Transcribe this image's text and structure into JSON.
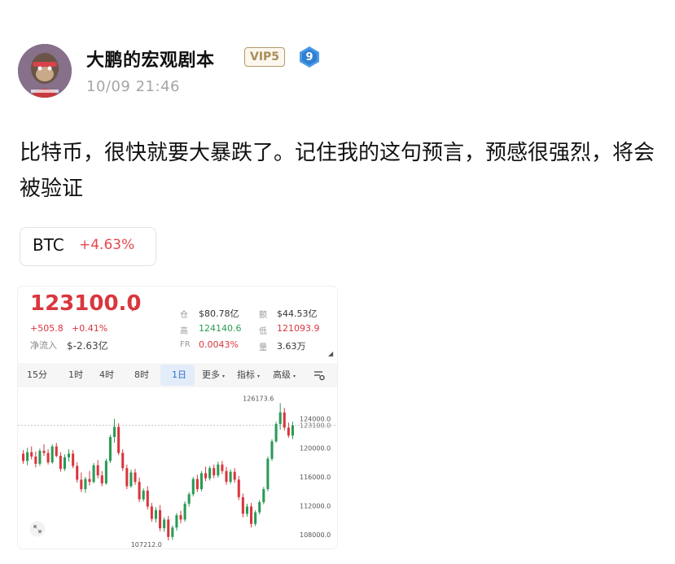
{
  "post": {
    "username": "大鹏的宏观剧本",
    "vip_badge": "VIP5",
    "level": "9",
    "timestamp": "10/09 21:46",
    "text": "比特币，很快就要大暴跌了。记住我的这句预言，预感很强烈，将会被验证"
  },
  "ticker_tag": {
    "symbol": "BTC",
    "change": "+4.63%"
  },
  "quote": {
    "price": "123100.0",
    "change_abs": "+505.8",
    "change_pct": "+0.41%",
    "net_inflow_label": "净流入",
    "net_inflow_value": "$-2.63亿",
    "stats": [
      {
        "label": "仓",
        "value": "$80.78亿",
        "value_color": "#333333"
      },
      {
        "label": "额",
        "value": "$44.53亿",
        "value_color": "#333333"
      },
      {
        "label": "高",
        "value": "124140.6",
        "value_color": "#2a9a55"
      },
      {
        "label": "低",
        "value": "121093.9",
        "value_color": "#d9363e"
      },
      {
        "label": "FR",
        "value": "0.0043%",
        "value_color": "#d9363e"
      },
      {
        "label": "量",
        "value": "3.63万",
        "value_color": "#333333"
      }
    ]
  },
  "timeframes": [
    "15分",
    "1时",
    "4时",
    "8时",
    "1日",
    "更多",
    "指标",
    "高级"
  ],
  "active_timeframe": "1日",
  "colors": {
    "up": "#2a9a55",
    "down": "#d9363e"
  },
  "chart_data": {
    "type": "candlestick",
    "y_ticks": [
      "124000.0",
      "123100.0",
      "120000.0",
      "116000.0",
      "112000.0",
      "108000.0"
    ],
    "annotations": {
      "high_label": "126173.6",
      "low_label": "107212.0"
    },
    "current_price": 123100.0,
    "ylim": [
      107000,
      127000
    ],
    "candles": [
      [
        119200,
        119700,
        117800,
        118200
      ],
      [
        118200,
        120000,
        117600,
        119400
      ],
      [
        119400,
        120200,
        118400,
        118800
      ],
      [
        118800,
        119500,
        117300,
        117800
      ],
      [
        117800,
        119900,
        117500,
        119600
      ],
      [
        119600,
        120500,
        118900,
        119300
      ],
      [
        119300,
        119800,
        117700,
        118000
      ],
      [
        118000,
        120500,
        117800,
        120200
      ],
      [
        120200,
        120700,
        118700,
        118900
      ],
      [
        118900,
        119400,
        116700,
        117100
      ],
      [
        117100,
        119100,
        116800,
        118700
      ],
      [
        118700,
        119800,
        118100,
        119200
      ],
      [
        119200,
        119700,
        117200,
        117500
      ],
      [
        117500,
        118000,
        115200,
        115600
      ],
      [
        115600,
        116600,
        113900,
        114300
      ],
      [
        114300,
        116000,
        113800,
        115700
      ],
      [
        115700,
        116800,
        114800,
        115300
      ],
      [
        115300,
        117900,
        115100,
        117600
      ],
      [
        117600,
        118300,
        115800,
        116200
      ],
      [
        116200,
        116800,
        114700,
        115100
      ],
      [
        115100,
        118500,
        114900,
        118200
      ],
      [
        118200,
        121800,
        117900,
        121500
      ],
      [
        121500,
        124000,
        120700,
        122900
      ],
      [
        122900,
        123400,
        119000,
        119300
      ],
      [
        119300,
        119800,
        116800,
        117200
      ],
      [
        117200,
        117700,
        114300,
        114700
      ],
      [
        114700,
        117000,
        114500,
        116600
      ],
      [
        116600,
        117100,
        114900,
        115300
      ],
      [
        115300,
        115900,
        112500,
        112900
      ],
      [
        112900,
        114400,
        112600,
        114100
      ],
      [
        114100,
        114700,
        111500,
        111900
      ],
      [
        111900,
        112400,
        109800,
        110200
      ],
      [
        110200,
        111800,
        109700,
        111400
      ],
      [
        111400,
        112100,
        108500,
        108900
      ],
      [
        108900,
        110400,
        108400,
        110100
      ],
      [
        110100,
        110600,
        107212,
        107700
      ],
      [
        107700,
        109300,
        107300,
        109000
      ],
      [
        109000,
        111000,
        108600,
        110700
      ],
      [
        110700,
        111300,
        109600,
        110100
      ],
      [
        110100,
        112600,
        109800,
        112300
      ],
      [
        112300,
        113900,
        111900,
        113600
      ],
      [
        113600,
        116000,
        113300,
        115700
      ],
      [
        115700,
        116300,
        113900,
        114300
      ],
      [
        114300,
        116800,
        114000,
        116500
      ],
      [
        116500,
        117400,
        115400,
        115800
      ],
      [
        115800,
        117500,
        115500,
        117200
      ],
      [
        117200,
        117700,
        115800,
        116200
      ],
      [
        116200,
        118100,
        115900,
        117700
      ],
      [
        117700,
        118200,
        116400,
        116800
      ],
      [
        116800,
        117400,
        114900,
        115300
      ],
      [
        115300,
        117000,
        115000,
        116700
      ],
      [
        116700,
        117200,
        115200,
        115600
      ],
      [
        115600,
        116100,
        112800,
        113200
      ],
      [
        113200,
        113700,
        110400,
        110900
      ],
      [
        110900,
        112300,
        110500,
        111900
      ],
      [
        111900,
        112400,
        109000,
        109500
      ],
      [
        109500,
        111400,
        109200,
        111100
      ],
      [
        111100,
        112800,
        110800,
        112500
      ],
      [
        112500,
        114600,
        112200,
        114300
      ],
      [
        114300,
        118800,
        114000,
        118500
      ],
      [
        118500,
        121200,
        118200,
        120900
      ],
      [
        120900,
        123600,
        120700,
        123300
      ],
      [
        123300,
        126173.6,
        122500,
        124900
      ],
      [
        124900,
        125500,
        122400,
        122800
      ],
      [
        122800,
        123500,
        121400,
        121700
      ],
      [
        121700,
        123600,
        121200,
        123100
      ]
    ]
  }
}
